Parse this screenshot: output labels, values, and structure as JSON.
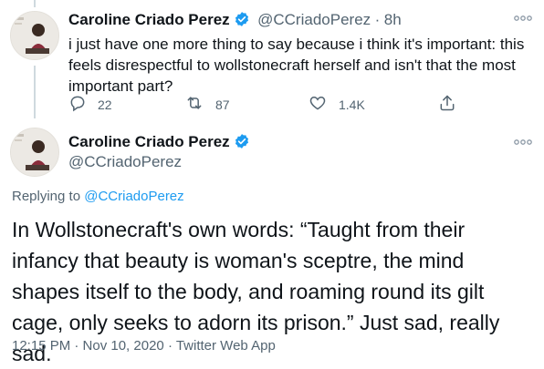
{
  "reply_tweet": {
    "author_name": "Caroline Criado Perez",
    "author_handle": "@CCriadoPerez",
    "separator": "·",
    "time_ago": "8h",
    "text": "i just have one more thing to say because i think it's important: this feels disrespectful to wollstonecraft herself and isn't that the most important part?",
    "reply_count": "22",
    "retweet_count": "87",
    "like_count": "1.4K"
  },
  "main_tweet": {
    "author_name": "Caroline Criado Perez",
    "author_handle": "@CCriadoPerez",
    "replying_to_prefix": "Replying to",
    "replying_to_handle": "@CCriadoPerez",
    "text": "In Wollstonecraft's own words: “Taught from their infancy that beauty is woman's sceptre, the mind shapes itself to the body, and roaming round its gilt cage, only seeks to adorn its prison.” Just sad, really sad.",
    "timestamp": "12:15 PM · Nov 10, 2020",
    "separator": "·",
    "source": "Twitter Web App"
  },
  "colors": {
    "verified_badge": "#1d9bf0",
    "link": "#1d9bf0",
    "muted_text": "#536471",
    "thread_line": "#cfd9de"
  },
  "icons": [
    "verified-badge-icon",
    "more-options-icon",
    "reply-icon",
    "retweet-icon",
    "like-icon",
    "share-icon"
  ]
}
